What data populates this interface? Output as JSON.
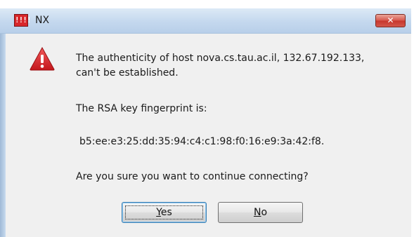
{
  "window": {
    "title": "NX",
    "app_icon_text": "!!!!"
  },
  "dialog": {
    "message_line1": "The authenticity of host nova.cs.tau.ac.il, 132.67.192.133,",
    "message_line2": "can't be established.",
    "fingerprint_label": "The RSA key fingerprint is:",
    "fingerprint_value": "b5:ee:e3:25:dd:35:94:c4:c1:98:f0:16:e9:3a:42:f8.",
    "question": "Are you sure you want to continue connecting?",
    "yes": {
      "mnemonic": "Y",
      "rest": "es"
    },
    "no": {
      "mnemonic": "N",
      "rest": "o"
    },
    "icon": "warning-icon"
  },
  "colors": {
    "titlebar": "#c4d8ee",
    "close_button": "#d2574c",
    "warning": "#e0282b"
  }
}
